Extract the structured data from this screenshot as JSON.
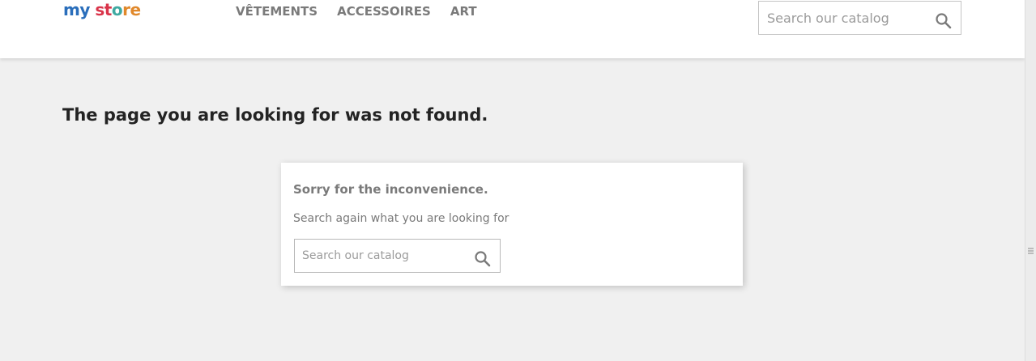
{
  "header": {
    "logo": {
      "part1": "my",
      "part2": " st",
      "part3": "o",
      "part4": "re"
    },
    "nav": [
      {
        "label": "VÊTEMENTS"
      },
      {
        "label": "ACCESSOIRES"
      },
      {
        "label": "ART"
      }
    ],
    "search": {
      "placeholder": "Search our catalog",
      "value": "",
      "icon": "search-icon"
    }
  },
  "main": {
    "title": "The page you are looking for was not found.",
    "card": {
      "heading": "Sorry for the inconvenience.",
      "text": "Search again what you are looking for",
      "search": {
        "placeholder": "Search our catalog",
        "value": "",
        "icon": "search-icon"
      }
    }
  },
  "colors": {
    "background": "#f0f0f0",
    "header_bg": "#ffffff",
    "text_dark": "#232323",
    "text_muted": "#7a7a7a"
  }
}
